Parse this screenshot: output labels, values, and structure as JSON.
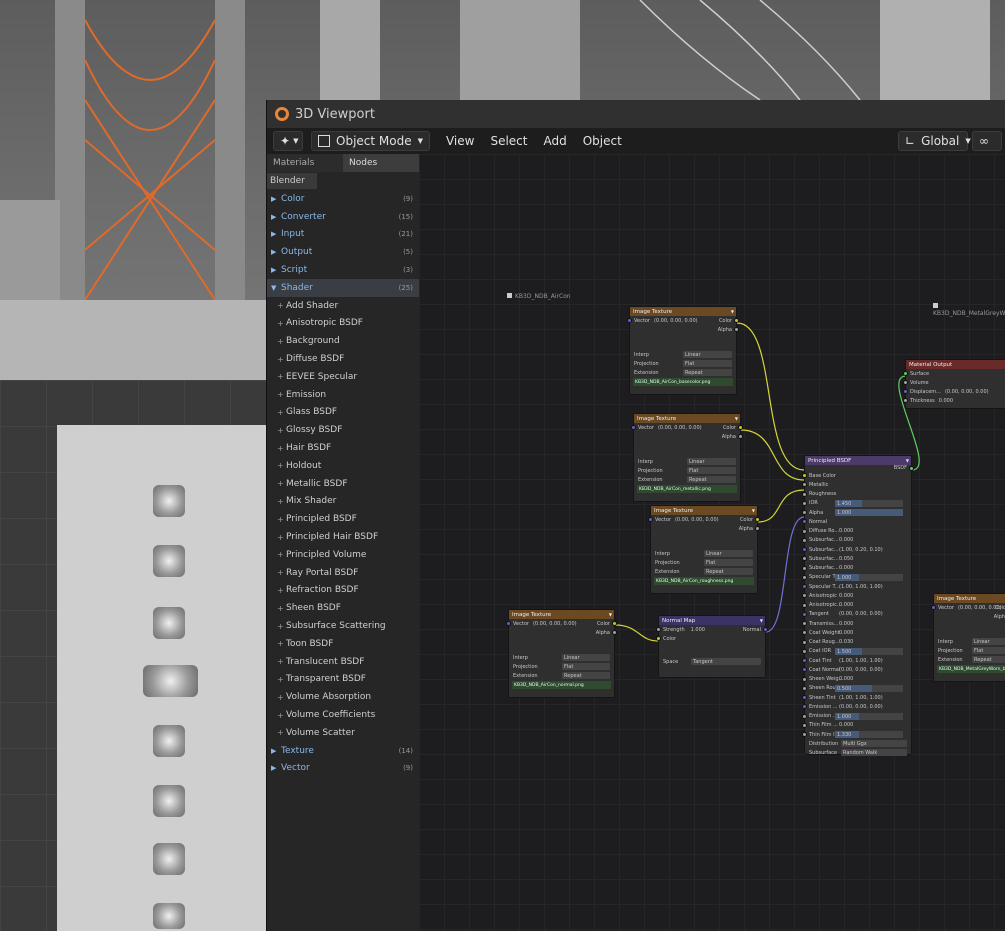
{
  "window": {
    "title": "3D Viewport"
  },
  "header": {
    "mode": "Object Mode",
    "menus": [
      "View",
      "Select",
      "Add",
      "Object"
    ],
    "orientation": "Global"
  },
  "sidebar": {
    "tabs": [
      "Materials",
      "Nodes"
    ],
    "source": "Blender",
    "categories_before": [
      {
        "label": "Color",
        "count": "(9)"
      },
      {
        "label": "Converter",
        "count": "(15)"
      },
      {
        "label": "Input",
        "count": "(21)"
      },
      {
        "label": "Output",
        "count": "(5)"
      },
      {
        "label": "Script",
        "count": "(3)"
      }
    ],
    "open_category": {
      "label": "Shader",
      "count": "(25)"
    },
    "shader_items": [
      "Add Shader",
      "Anisotropic BSDF",
      "Background",
      "Diffuse BSDF",
      "EEVEE Specular",
      "Emission",
      "Glass BSDF",
      "Glossy BSDF",
      "Hair BSDF",
      "Holdout",
      "Metallic BSDF",
      "Mix Shader",
      "Principled BSDF",
      "Principled Hair BSDF",
      "Principled Volume",
      "Ray Portal BSDF",
      "Refraction BSDF",
      "Sheen BSDF",
      "Subsurface Scattering",
      "Toon BSDF",
      "Translucent BSDF",
      "Transparent BSDF",
      "Volume Absorption",
      "Volume Coefficients",
      "Volume Scatter"
    ],
    "categories_after": [
      {
        "label": "Texture",
        "count": "(14)"
      },
      {
        "label": "Vector",
        "count": "(9)"
      }
    ]
  },
  "canvas": {
    "object_labels": [
      "KB3D_NDB_AirCon",
      "KB3D_NDB_MetalGreyW"
    ],
    "image_node": {
      "title": "Image Texture",
      "vector_label": "Vector",
      "vector_value": "(0.00, 0.00, 0.00)",
      "out_color": "Color",
      "out_alpha": "Alpha",
      "interp_label": "Interp",
      "interp": "Linear",
      "proj_label": "Projection",
      "proj": "Flat",
      "ext_label": "Extension",
      "ext": "Repeat"
    },
    "image_files": [
      "KB3D_NDB_AirCon_basecolor.png",
      "KB3D_NDB_AirCon_metallic.png",
      "KB3D_NDB_AirCon_roughness.png",
      "KB3D_NDB_AirCon_normal.png",
      "KB3D_NDB_MetalGreyWorn_b"
    ],
    "normal_map": {
      "title": "Normal Map",
      "strength_label": "Strength",
      "strength": "1.000",
      "color_label": "Color",
      "out": "Normal",
      "space_label": "Space",
      "space": "Tangent"
    },
    "material_output": {
      "title": "Material Output",
      "rows": [
        {
          "label": "Surface",
          "value": ""
        },
        {
          "label": "Volume",
          "value": ""
        },
        {
          "label": "Displacem...",
          "value": "(0.00, 0.00, 0.00)"
        },
        {
          "label": "Thickness",
          "value": "0.000"
        }
      ]
    },
    "bsdf": {
      "title": "Principled BSDF",
      "out": "BSDF",
      "rows": [
        {
          "label": "Base Color",
          "value": ""
        },
        {
          "label": "Metallic",
          "value": ""
        },
        {
          "label": "Roughness",
          "value": ""
        },
        {
          "label": "IOR",
          "value": "1.450"
        },
        {
          "label": "Alpha",
          "value": "1.000"
        },
        {
          "label": "Normal",
          "value": ""
        },
        {
          "label": "Diffuse Ro...",
          "value": "0.000"
        },
        {
          "label": "Subsurfac...",
          "value": "0.000"
        },
        {
          "label": "Subsurfac...",
          "value": "(1.00, 0.20, 0.10)"
        },
        {
          "label": "Subsurfac...",
          "value": "0.050"
        },
        {
          "label": "Subsurfac...",
          "value": "0.000"
        },
        {
          "label": "Specular T...",
          "value": "1.000"
        },
        {
          "label": "Specular T...",
          "value": "(1.00, 1.00, 1.00)"
        },
        {
          "label": "Anisotropic",
          "value": "0.000"
        },
        {
          "label": "Anisotropic...",
          "value": "0.000"
        },
        {
          "label": "Tangent",
          "value": "(0.00, 0.00, 0.00)"
        },
        {
          "label": "Transmiss...",
          "value": "0.000"
        },
        {
          "label": "Coat Weight",
          "value": "0.000"
        },
        {
          "label": "Coat Roug...",
          "value": "0.030"
        },
        {
          "label": "Coat IOR",
          "value": "1.500"
        },
        {
          "label": "Coat Tint",
          "value": "(1.00, 1.00, 1.00)"
        },
        {
          "label": "Coat Normal",
          "value": "(0.00, 0.00, 0.00)"
        },
        {
          "label": "Sheen Weig...",
          "value": "0.000"
        },
        {
          "label": "Sheen Rou...",
          "value": "0.500"
        },
        {
          "label": "Sheen Tint",
          "value": "(1.00, 1.00, 1.00)"
        },
        {
          "label": "Emission ...",
          "value": "(0.00, 0.00, 0.00)"
        },
        {
          "label": "Emission ...",
          "value": "1.000"
        },
        {
          "label": "Thin Film ...",
          "value": "0.000"
        },
        {
          "label": "Thin Film I...",
          "value": "1.330"
        }
      ],
      "distribution_label": "Distribution",
      "distribution": "Multi Ggx",
      "subsurface_label": "Subsurface",
      "subsurface": "Random Walk"
    }
  }
}
